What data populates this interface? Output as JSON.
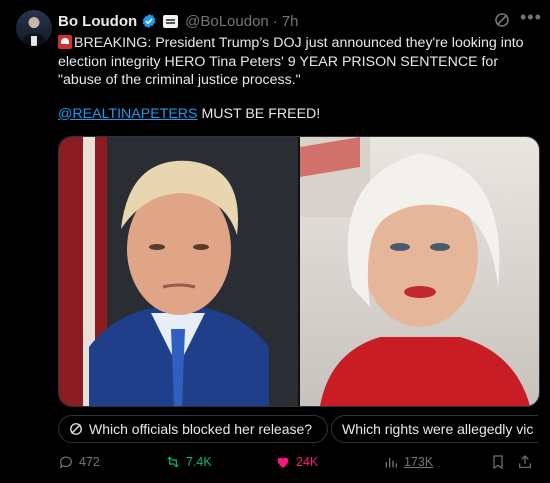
{
  "author": {
    "display_name": "Bo Loudon",
    "handle": "@BoLoudon",
    "separator": "·",
    "time": "7h"
  },
  "post": {
    "line1_prefix": "BREAKING: President Trump’s DOJ just announced they're looking into election integrity HERO Tina Peters' 9 YEAR PRISON SENTENCE for \"abuse of the criminal justice process.\"",
    "mention": "@REALTINAPETERS",
    "mention_suffix": " MUST BE FREED!"
  },
  "media": {
    "left_photo": "portrait-man-suit",
    "right_photo": "portrait-woman-red-jacket"
  },
  "suggestions": [
    {
      "label": "Which officials blocked her release?"
    },
    {
      "label": "Which rights were allegedly vic"
    }
  ],
  "actions": {
    "replies": "472",
    "reposts": "7.4K",
    "likes": "24K",
    "views": "173K"
  },
  "colors": {
    "background": "#000000",
    "text": "#e7e9ea",
    "muted": "#71767b",
    "link": "#1d9bf0",
    "repost": "#00ba7c",
    "like": "#f91880"
  }
}
